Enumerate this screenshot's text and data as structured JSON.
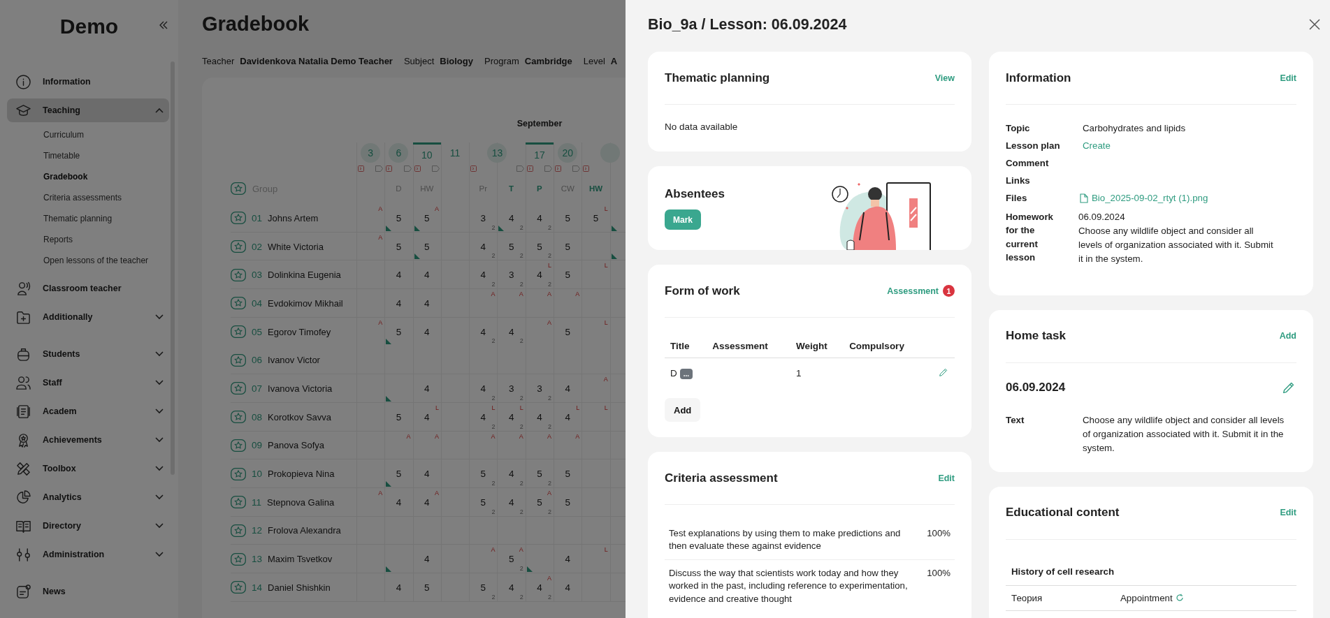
{
  "sidebar": {
    "logo": "Demo",
    "sections": [
      [
        {
          "label": "Information",
          "kind": "link",
          "selected": false
        },
        {
          "label": "Teaching",
          "kind": "group",
          "selected": true,
          "expanded": true,
          "children": [
            {
              "label": "Curriculum",
              "selected": false
            },
            {
              "label": "Timetable",
              "selected": false
            },
            {
              "label": "Gradebook",
              "selected": true
            },
            {
              "label": "Criteria assessments",
              "selected": false
            },
            {
              "label": "Thematic planning",
              "selected": false
            },
            {
              "label": "Reports",
              "selected": false
            },
            {
              "label": "Open lessons of the teacher",
              "selected": false
            }
          ]
        },
        {
          "label": "Classroom teacher",
          "kind": "link",
          "selected": false
        },
        {
          "label": "Additionally",
          "kind": "group",
          "selected": false,
          "expanded": false
        }
      ],
      [
        {
          "label": "Students",
          "kind": "group",
          "selected": false,
          "expanded": false
        },
        {
          "label": "Staff",
          "kind": "group",
          "selected": false,
          "expanded": false
        },
        {
          "label": "Academ",
          "kind": "group",
          "selected": false,
          "expanded": false
        },
        {
          "label": "Achievements",
          "kind": "group",
          "selected": false,
          "expanded": false
        },
        {
          "label": "Toolbox",
          "kind": "group",
          "selected": false,
          "expanded": false
        },
        {
          "label": "Analytics",
          "kind": "group",
          "selected": false,
          "expanded": false
        },
        {
          "label": "Directory",
          "kind": "group",
          "selected": false,
          "expanded": false
        },
        {
          "label": "Administration",
          "kind": "group",
          "selected": false,
          "expanded": false
        }
      ],
      [
        {
          "label": "News",
          "kind": "link",
          "selected": false
        }
      ]
    ]
  },
  "gradebook": {
    "title": "Gradebook",
    "filters": [
      {
        "label": "Teacher",
        "value": "Davidenkova Natalia Demo Teacher"
      },
      {
        "label": "Subject",
        "value": "Biology"
      },
      {
        "label": "Program",
        "value": "Cambridge"
      },
      {
        "label": "Level",
        "value": "A"
      }
    ],
    "month": "September",
    "group_label": "Group",
    "lessons": [
      {
        "day": "3",
        "kind": "circle",
        "columns": [
          {}
        ]
      },
      {
        "day": "6",
        "kind": "circle",
        "columns": [
          {
            "type": "D",
            "emphasis": false
          }
        ]
      },
      {
        "day": "10",
        "kind": "current",
        "columns": [
          {
            "type": "HW",
            "emphasis": false
          }
        ]
      },
      {
        "day": "11",
        "kind": "plain",
        "columns": [
          {}
        ]
      },
      {
        "day": "13",
        "kind": "circle",
        "columns": [
          {
            "type": "Pr",
            "emphasis": false
          },
          {
            "type": "T",
            "emphasis": true
          }
        ]
      },
      {
        "day": "17",
        "kind": "current",
        "columns": [
          {
            "type": "P",
            "emphasis": true
          }
        ]
      },
      {
        "day": "20",
        "kind": "circle",
        "columns": [
          {
            "type": "CW",
            "emphasis": false
          }
        ]
      },
      {
        "kind": "circle",
        "columns": [
          {
            "type": "HW",
            "emphasis": true
          },
          {}
        ]
      }
    ],
    "students": [
      {
        "number": "01",
        "name": "Johns Artem",
        "cells": [
          {
            "note": "A"
          },
          {
            "grade": "5",
            "flag": true
          },
          {
            "grade": "5",
            "note": "A",
            "flag": true
          },
          {},
          {
            "grade": "3",
            "weight": "2"
          },
          {
            "grade": "4",
            "weight": "2",
            "flag": true
          },
          {
            "grade": "4",
            "weight": "2"
          },
          {
            "grade": "5"
          },
          {
            "grade": "5",
            "note": "L"
          },
          {
            "flag": true
          }
        ]
      },
      {
        "number": "02",
        "name": "White Victoria",
        "cells": [
          {
            "note": "A"
          },
          {
            "grade": "5"
          },
          {
            "grade": "5",
            "flag": true
          },
          {},
          {
            "grade": "4",
            "weight": "2"
          },
          {
            "grade": "5",
            "weight": "2"
          },
          {
            "grade": "5",
            "weight": "2"
          },
          {
            "grade": "5"
          },
          {},
          {
            "flag": true
          }
        ]
      },
      {
        "number": "03",
        "name": "Dolinkina Eugenia",
        "cells": [
          {},
          {
            "grade": "4"
          },
          {
            "grade": "4"
          },
          {},
          {
            "grade": "4",
            "weight": "2"
          },
          {
            "grade": "3",
            "weight": "2"
          },
          {
            "grade": "4",
            "weight": "2",
            "note": "L"
          },
          {
            "grade": "5"
          },
          {
            "note": "L"
          },
          {}
        ]
      },
      {
        "number": "04",
        "name": "Evdokimov Mikhail",
        "cells": [
          {},
          {
            "grade": "4"
          },
          {
            "grade": "4"
          },
          {},
          {
            "note": "A"
          },
          {
            "note": "A"
          },
          {
            "note": "A"
          },
          {
            "note": "A"
          },
          {},
          {}
        ]
      },
      {
        "number": "05",
        "name": "Egorov Timofey",
        "cells": [
          {
            "note": "A"
          },
          {
            "grade": "5",
            "flag": true
          },
          {
            "grade": "4"
          },
          {},
          {
            "grade": "4",
            "weight": "2"
          },
          {
            "grade": "4",
            "weight": "2"
          },
          {
            "note": "A"
          },
          {
            "grade": "5"
          },
          {
            "note": "L"
          },
          {}
        ]
      },
      {
        "number": "06",
        "name": "Ivanov Victor",
        "cells": [
          {},
          {},
          {},
          {},
          {},
          {},
          {},
          {},
          {},
          {}
        ]
      },
      {
        "number": "07",
        "name": "Ivanova Victoria",
        "cells": [
          {},
          {
            "flag": true
          },
          {
            "grade": "4"
          },
          {},
          {
            "grade": "4",
            "weight": "2"
          },
          {
            "grade": "3",
            "weight": "2"
          },
          {
            "grade": "3",
            "weight": "2"
          },
          {
            "grade": "4"
          },
          {
            "note": "A"
          },
          {}
        ]
      },
      {
        "number": "08",
        "name": "Korotkov Savva",
        "cells": [
          {},
          {
            "grade": "5"
          },
          {
            "grade": "4",
            "note": "L"
          },
          {},
          {
            "grade": "4",
            "weight": "2",
            "note": "L"
          },
          {
            "grade": "4",
            "weight": "2",
            "note": "L"
          },
          {
            "grade": "4",
            "weight": "2"
          },
          {
            "grade": "4",
            "note": "L"
          },
          {
            "note": "L"
          },
          {}
        ]
      },
      {
        "number": "09",
        "name": "Panova Sofya",
        "cells": [
          {},
          {
            "note": "A"
          },
          {
            "note": "A"
          },
          {},
          {
            "note": "A"
          },
          {
            "note": "A"
          },
          {
            "note": "A"
          },
          {
            "note": "A"
          },
          {},
          {}
        ]
      },
      {
        "number": "10",
        "name": "Prokopieva Nina",
        "cells": [
          {},
          {
            "grade": "5",
            "flag": true
          },
          {
            "grade": "4"
          },
          {},
          {
            "grade": "5",
            "weight": "2"
          },
          {
            "grade": "4",
            "weight": "2"
          },
          {
            "grade": "5",
            "weight": "2"
          },
          {
            "grade": "5"
          },
          {},
          {}
        ]
      },
      {
        "number": "11",
        "name": "Stepnova Galina",
        "cells": [
          {
            "note": "A"
          },
          {
            "grade": "4"
          },
          {
            "grade": "4",
            "note": "A"
          },
          {},
          {
            "grade": "5",
            "weight": "2"
          },
          {
            "grade": "4",
            "weight": "2"
          },
          {
            "grade": "5",
            "weight": "2",
            "note": "A"
          },
          {
            "grade": "5"
          },
          {},
          {}
        ]
      },
      {
        "number": "12",
        "name": "Frolova Alexandra",
        "cells": [
          {},
          {},
          {},
          {},
          {},
          {},
          {},
          {},
          {},
          {}
        ]
      },
      {
        "number": "13",
        "name": "Maxim Tsvetkov",
        "cells": [
          {},
          {
            "flag": true
          },
          {
            "grade": "4"
          },
          {},
          {
            "note": "A"
          },
          {
            "grade": "5",
            "weight": "2",
            "note": "A"
          },
          {
            "flag": true
          },
          {
            "grade": "4"
          },
          {
            "note": "L"
          },
          {}
        ]
      },
      {
        "number": "14",
        "name": "Daniel Shishkin",
        "cells": [
          {},
          {
            "grade": "4"
          },
          {
            "grade": "5"
          },
          {},
          {
            "grade": "5",
            "weight": "2"
          },
          {
            "grade": "4",
            "weight": "2"
          },
          {
            "grade": "4",
            "weight": "2",
            "note": "A"
          },
          {
            "grade": "4"
          },
          {},
          {}
        ]
      }
    ]
  },
  "drawer": {
    "title": "Bio_9a / Lesson: 06.09.2024",
    "thematic_planning": {
      "title": "Thematic planning",
      "action": "View",
      "text": "No data available"
    },
    "absentees": {
      "title": "Absentees",
      "button": "Mark"
    },
    "form_of_work": {
      "title": "Form of work",
      "action": "Assessment",
      "badge": "1",
      "columns": [
        "Title",
        "Assessment",
        "Weight",
        "Compulsory"
      ],
      "rows": [
        {
          "title": "D",
          "tag": "...",
          "weight": "1"
        }
      ],
      "add_button": "Add"
    },
    "criteria_assessment": {
      "title": "Criteria assessment",
      "action": "Edit",
      "rows": [
        {
          "text": "Test explanations by using them to make predictions and then evaluate these against evidence",
          "percent": "100%"
        },
        {
          "text": "Discuss the way that scientists work today and how they worked in the past, including reference to experimentation, evidence and creative thought",
          "percent": "100%"
        }
      ]
    },
    "information": {
      "title": "Information",
      "action": "Edit",
      "rows": [
        {
          "label": "Topic",
          "kind": "text",
          "value": "Carbohydrates and lipids"
        },
        {
          "label": "Lesson plan",
          "kind": "link",
          "value": "Create"
        },
        {
          "label": "Comment",
          "kind": "empty"
        },
        {
          "label": "Links",
          "kind": "empty"
        },
        {
          "label": "Files",
          "kind": "file",
          "value": "Bio_2025-09-02_rtyt (1).png"
        },
        {
          "label": "Homework for the current lesson",
          "kind": "homework",
          "date": "06.09.2024",
          "value": "Choose any wildlife object and consider all levels of organization associated with it. Submit it in the system."
        }
      ]
    },
    "home_task": {
      "title": "Home task",
      "action": "Add",
      "date": "06.09.2024",
      "label": "Text",
      "text": "Choose any wildlife object and consider all levels of organization associated with it. Submit it in the system."
    },
    "educational_content": {
      "title": "Educational content",
      "action": "Edit",
      "heading": "History of cell research",
      "rows": [
        {
          "label": "Теория",
          "value": "Appointment"
        }
      ]
    }
  }
}
